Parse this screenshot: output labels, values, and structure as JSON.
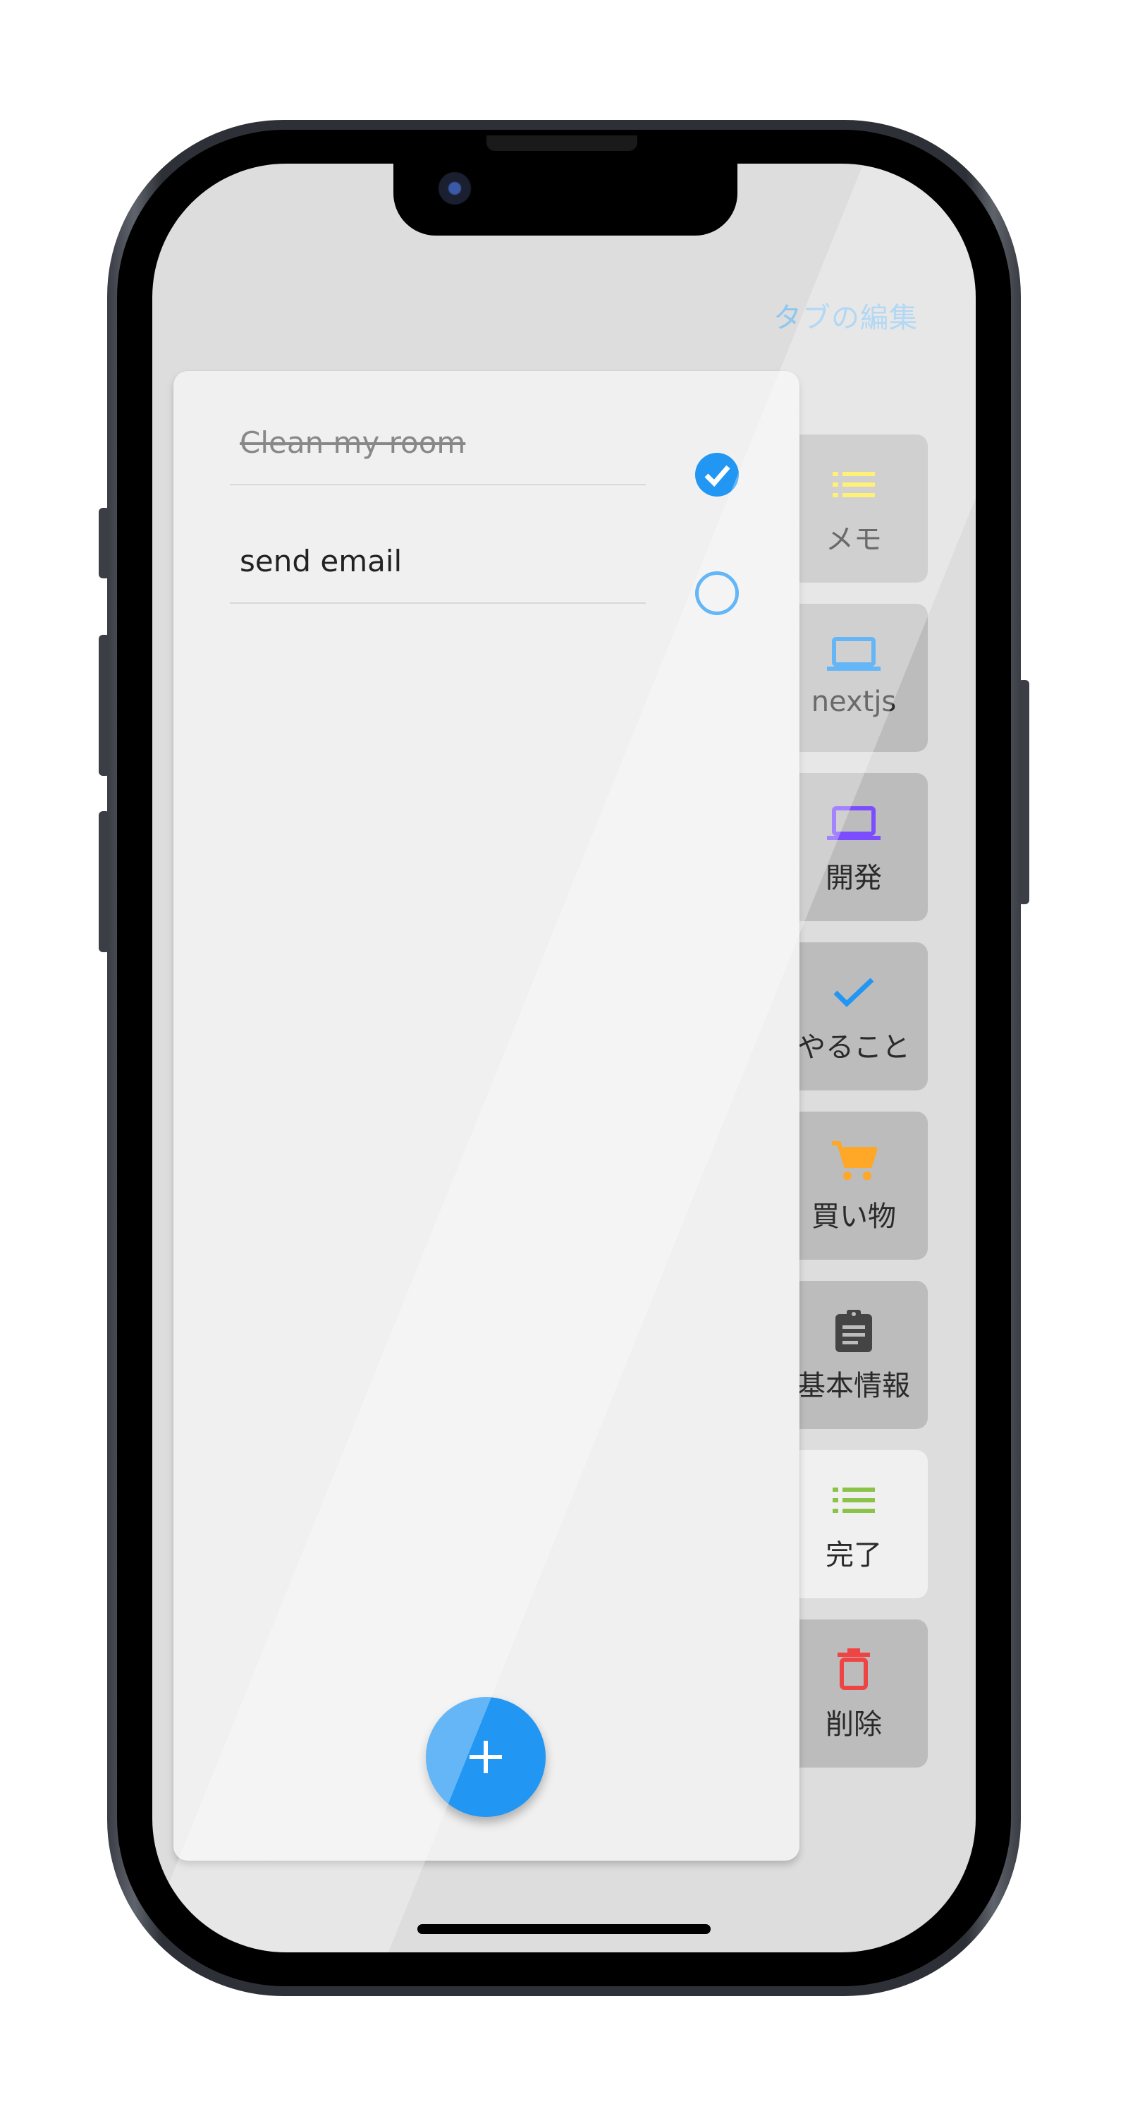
{
  "header": {
    "edit_tabs_label": "タブの編集"
  },
  "tasks": [
    {
      "text": "Clean my room",
      "done": true
    },
    {
      "text": "send email",
      "done": false
    }
  ],
  "tabs": [
    {
      "label": "メモ",
      "icon": "list-icon",
      "color": "#ffeb3b"
    },
    {
      "label": "nextjs",
      "icon": "laptop-icon",
      "color": "#2196f3"
    },
    {
      "label": "開発",
      "icon": "laptop-icon",
      "color": "#7c4dff"
    },
    {
      "label": "やること",
      "icon": "check-icon",
      "color": "#2196f3"
    },
    {
      "label": "買い物",
      "icon": "cart-icon",
      "color": "#ffa726"
    },
    {
      "label": "基本情報",
      "icon": "clipboard-icon",
      "color": "#444444"
    },
    {
      "label": "完了",
      "icon": "list-icon",
      "color": "#8bc34a",
      "active": true
    },
    {
      "label": "削除",
      "icon": "trash-icon",
      "color": "#ef4444"
    }
  ],
  "fab": {
    "icon": "plus-icon"
  }
}
